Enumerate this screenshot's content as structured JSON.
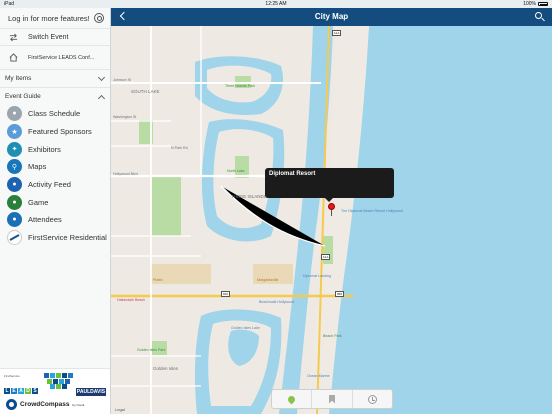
{
  "status_bar": {
    "left": "iPad",
    "time": "12:25 AM",
    "battery": "100%"
  },
  "sidebar": {
    "login_text": "Log in for more features!",
    "switch_event": "Switch Event",
    "event_name": "FirstService LEADS Conf...",
    "my_items": "My Items",
    "event_guide": "Event Guide",
    "nav_items": [
      {
        "label": "Class Schedule",
        "icon": "class-schedule-icon",
        "color": "#9aa5ad"
      },
      {
        "label": "Featured Sponsors",
        "icon": "featured-sponsors-icon",
        "color": "#5a9bd8"
      },
      {
        "label": "Exhibitors",
        "icon": "exhibitors-icon",
        "color": "#1f8fb3"
      },
      {
        "label": "Maps",
        "icon": "maps-icon",
        "color": "#1976b8"
      },
      {
        "label": "Activity Feed",
        "icon": "activity-feed-icon",
        "color": "#1e63b0"
      },
      {
        "label": "Game",
        "icon": "game-icon",
        "color": "#2a7f3a"
      },
      {
        "label": "Attendees",
        "icon": "attendees-icon",
        "color": "#1a6fb6"
      },
      {
        "label": "FirstService Residential",
        "icon": "firstservice-residential-icon",
        "color": "#ffffff"
      }
    ],
    "footer": {
      "tagline": "FirstService",
      "leads_letters": [
        "L",
        "E",
        "A",
        "D",
        "S"
      ],
      "paul_davis": "PAULDAVIS",
      "crowdcompass": "CrowdCompass",
      "crowdcompass_by": "by Cvent"
    }
  },
  "header": {
    "title": "City Map"
  },
  "map": {
    "callout_title": "Diplomat Resort",
    "legal": "Legal",
    "labels": {
      "south_lake": "SOUTH LAKE",
      "three_islands": "THREE ISLANDS",
      "three_islands_park": "Three Islands Park",
      "ocean_drive": "N Ocean Dr",
      "n_park_rd": "N Park Rd",
      "johnson_st": "Johnson St",
      "washington_st": "Washington St",
      "hollywood_blvd": "Hollywood Blvd",
      "golden_isles": "Golden Isles",
      "golden_isles_park": "Golden Isles Park",
      "diplomat_landing": "Diplomat Landing",
      "beachwalk": "Beachwalk Hollywood",
      "margaritaville": "Margaritaville",
      "publix": "Publix",
      "hallandale_beach": "Hallandale Beach",
      "diplomat_resort": "The Diplomat Beach Resort Hollywood",
      "oceanfront": "Oceanfront Park",
      "gulfstream": "Gulfstream Park",
      "state_a1a": "A1A",
      "route_820": "820",
      "route_858": "858",
      "north_lake": "North Lake",
      "fire": "Fire Station",
      "golden_lake": "Golden Isles Lake",
      "wells": "Wellness Center",
      "ocean_marine": "Ocean Marine",
      "beach_park": "Beach Park",
      "sea_marina": "Sea Marina"
    }
  },
  "toolbar": {
    "items": [
      "location-pin-icon",
      "bookmark-icon",
      "alarm-clock-icon"
    ]
  }
}
